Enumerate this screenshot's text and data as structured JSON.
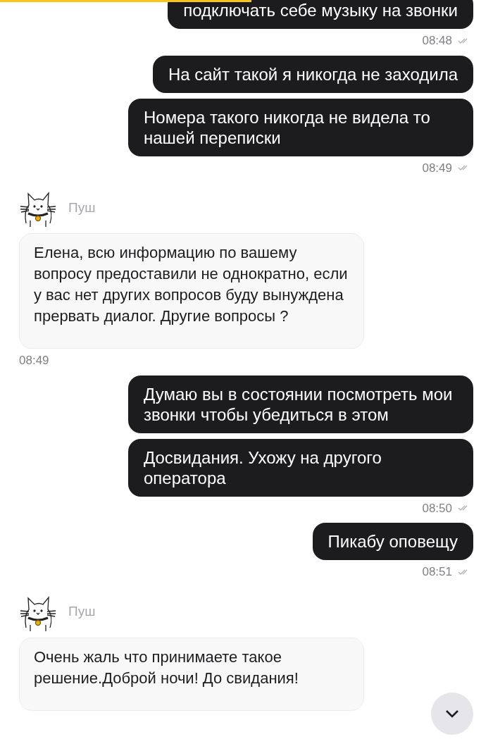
{
  "messages": [
    {
      "kind": "outgoing",
      "texts": [
        "подключать себе музыку на звонки"
      ],
      "time": "08:48",
      "read": true
    },
    {
      "kind": "outgoing",
      "texts": [
        "На сайт такой я никогда не заходила",
        "Номера такого никогда не видела то нашей переписки"
      ],
      "time": "08:49",
      "read": true
    },
    {
      "kind": "incoming",
      "sender": "Пуш",
      "texts": [
        "Елена, всю информацию по вашему вопросу предоставили не однократно, если у вас нет других вопросов буду вынуждена прервать диалог. Другие вопросы ?"
      ],
      "time": "08:49"
    },
    {
      "kind": "outgoing",
      "texts": [
        "Думаю вы в состоянии посмотреть мои звонки чтобы убедиться в этом",
        "Досвидания. Ухожу на другого оператора"
      ],
      "time": "08:50",
      "read": true
    },
    {
      "kind": "outgoing",
      "texts": [
        "Пикабу оповещу"
      ],
      "time": "08:51",
      "read": true
    },
    {
      "kind": "incoming",
      "sender": "Пуш",
      "texts": [
        "Очень жаль что принимаете такое решение.Доброй ночи! До свидания!"
      ]
    }
  ]
}
